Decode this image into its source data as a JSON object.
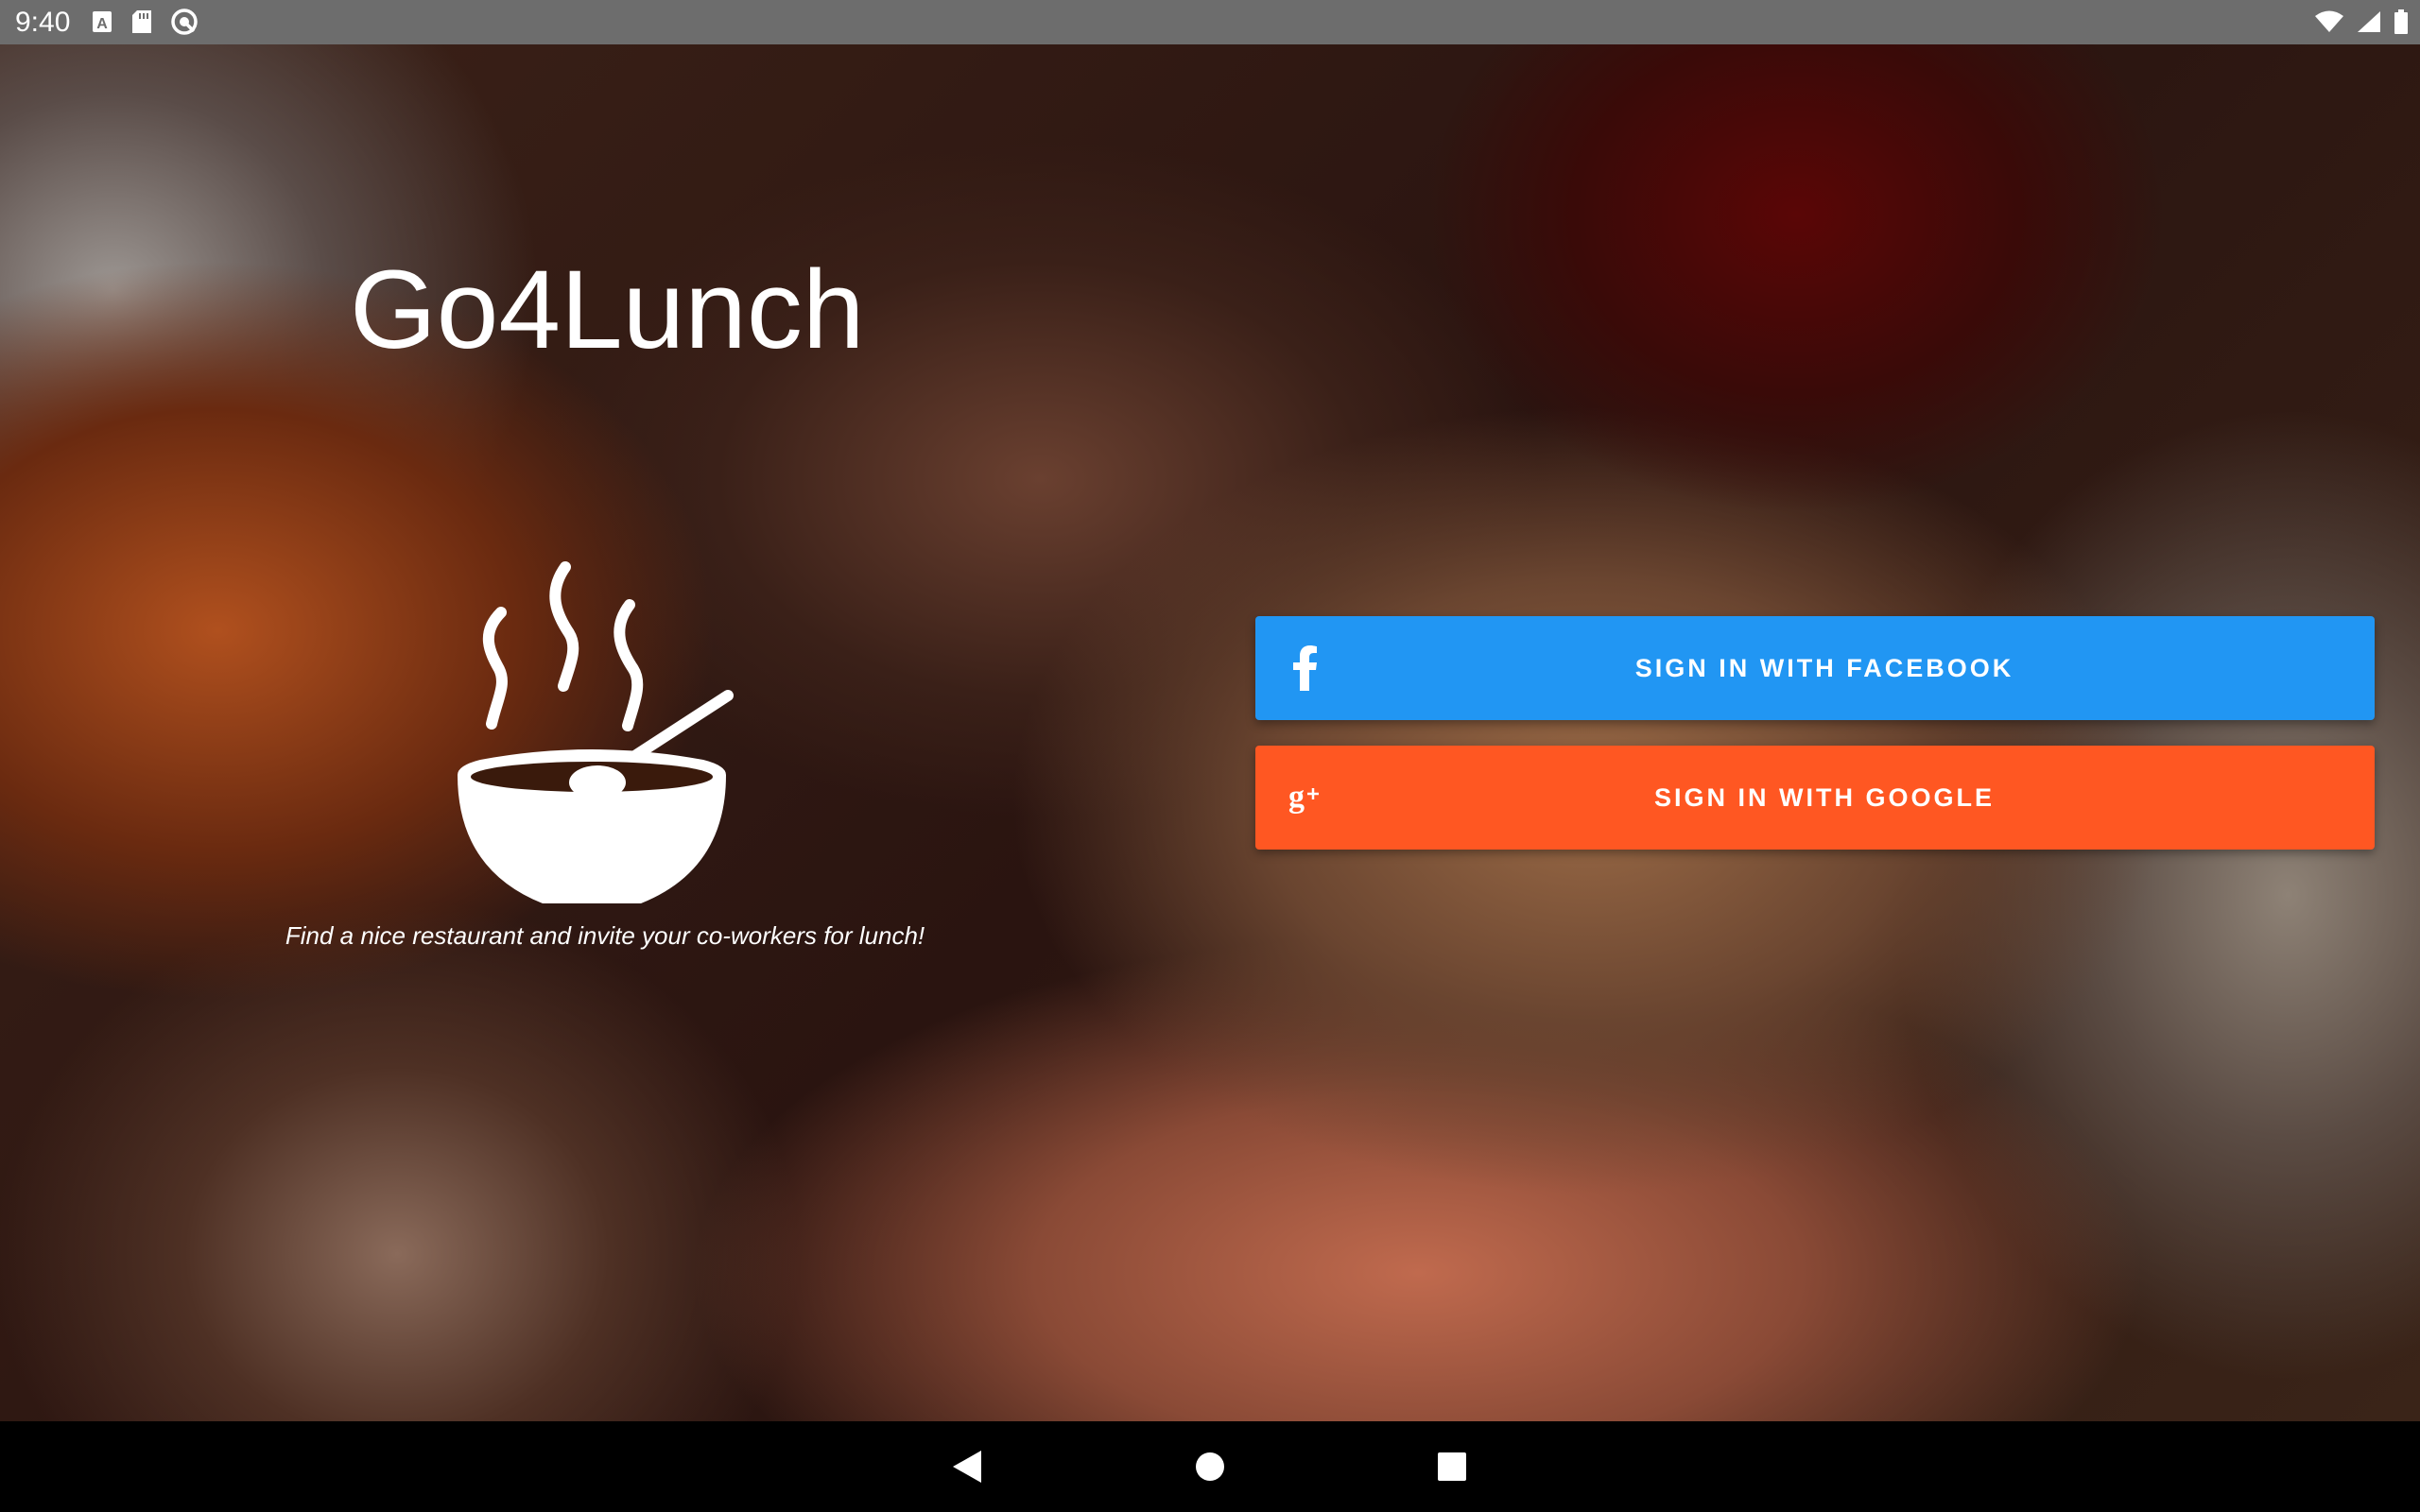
{
  "status_bar": {
    "time": "9:40",
    "icons": [
      "a-keyboard-icon",
      "sd-card-icon",
      "sync-icon",
      "wifi-icon",
      "signal-icon",
      "battery-icon"
    ]
  },
  "app": {
    "title": "Go4Lunch",
    "tagline": "Find a nice restaurant and invite your co-workers for lunch!",
    "logo_icon": "soup-bowl-icon"
  },
  "buttons": {
    "facebook": {
      "label": "SIGN IN WITH FACEBOOK",
      "icon": "facebook-icon",
      "color": "#2196f3"
    },
    "google": {
      "label": "SIGN IN WITH GOOGLE",
      "icon": "google-plus-icon",
      "color": "#ff5722"
    }
  },
  "navigation": {
    "back_icon": "back-triangle-icon",
    "home_icon": "home-circle-icon",
    "recent_icon": "recent-apps-square-icon"
  }
}
